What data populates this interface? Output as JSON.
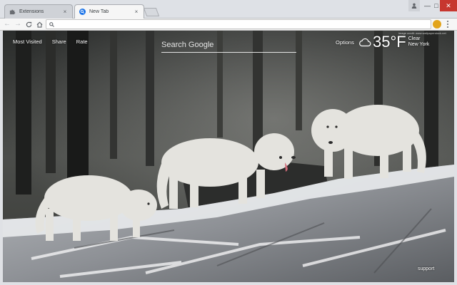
{
  "tabs": [
    {
      "label": "Extensions",
      "icon": "puzzle-icon",
      "active": false
    },
    {
      "label": "New Tab",
      "icon": "search-icon",
      "active": true
    }
  ],
  "omnibox": {
    "value": "",
    "placeholder": ""
  },
  "ntp": {
    "links": [
      "Most Visited",
      "Share",
      "Rate"
    ],
    "search_placeholder": "Search Google",
    "options_label": "Options",
    "weather": {
      "temp": "35°F",
      "condition": "Clear",
      "location": "New York",
      "icon": "cloud-icon"
    },
    "photo_credit": "image credit: www.wallpaperstock.net",
    "support_label": "support"
  },
  "colors": {
    "chrome_bg": "#dee1e6",
    "toolbar_bg": "#f6f6f6",
    "close_red": "#c7372f",
    "accent_blue": "#1a73e8"
  }
}
